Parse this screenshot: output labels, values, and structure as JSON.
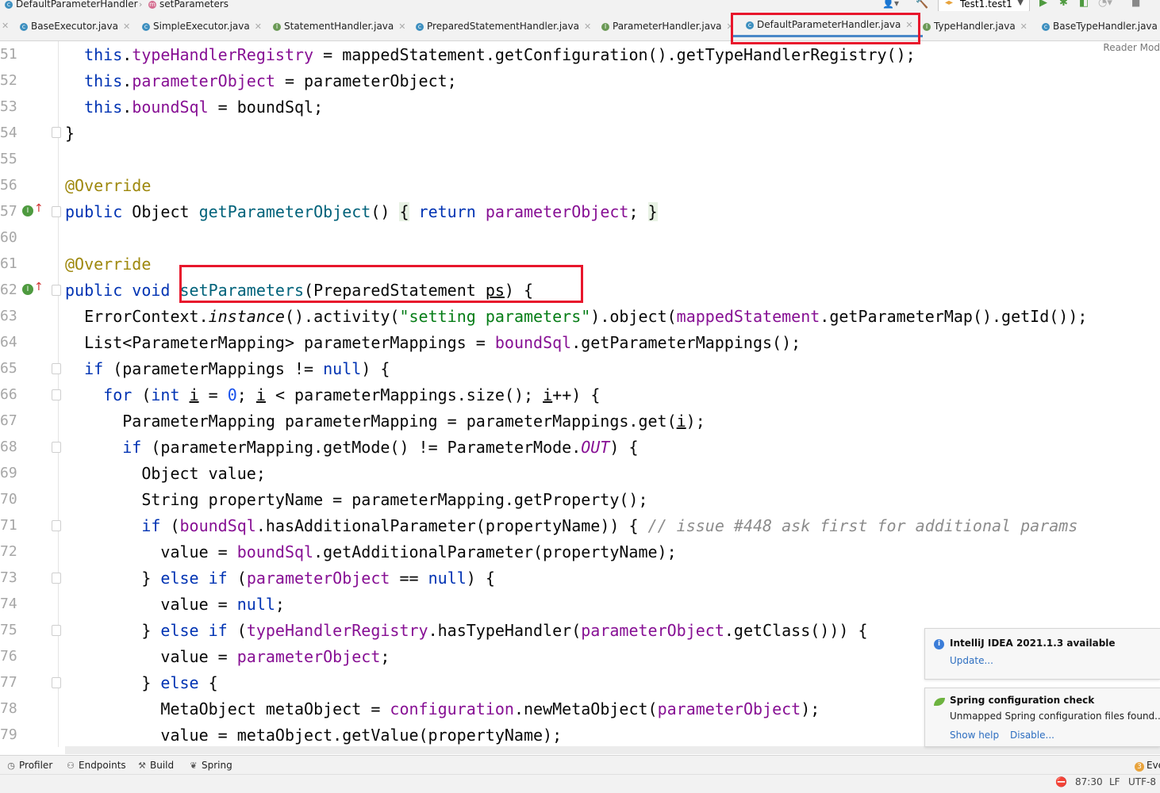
{
  "breadcrumb": {
    "items": [
      {
        "icon": "class-icon",
        "label": "DefaultParameterHandler"
      },
      {
        "icon": "method-icon",
        "label": "setParameters"
      }
    ]
  },
  "toolbar": {
    "run_config": "Test1.test1"
  },
  "tabs": [
    {
      "label": "BaseExecutor.java",
      "icon": "class-icon",
      "active": false
    },
    {
      "label": "SimpleExecutor.java",
      "icon": "class-icon",
      "active": false
    },
    {
      "label": "StatementHandler.java",
      "icon": "interface-icon",
      "active": false
    },
    {
      "label": "PreparedStatementHandler.java",
      "icon": "class-icon",
      "active": false
    },
    {
      "label": "ParameterHandler.java",
      "icon": "interface-icon",
      "active": false
    },
    {
      "label": "DefaultParameterHandler.java",
      "icon": "class-icon",
      "active": true
    },
    {
      "label": "TypeHandler.java",
      "icon": "interface-icon",
      "active": false
    },
    {
      "label": "BaseTypeHandler.java",
      "icon": "class-icon",
      "active": false
    }
  ],
  "editor": {
    "reader_mode": "Reader Mod",
    "line_numbers": [
      "51",
      "52",
      "53",
      "54",
      "55",
      "56",
      "57",
      "60",
      "61",
      "62",
      "63",
      "64",
      "65",
      "66",
      "67",
      "68",
      "69",
      "70",
      "71",
      "72",
      "73",
      "74",
      "75",
      "76",
      "77",
      "78",
      "79"
    ],
    "comment_issue": "// issue #448 ask first for additional params"
  },
  "tool_windows": [
    {
      "label": "Profiler",
      "icon": "profiler-icon"
    },
    {
      "label": "Endpoints",
      "icon": "endpoints-icon"
    },
    {
      "label": "Build",
      "icon": "hammer-icon"
    },
    {
      "label": "Spring",
      "icon": "spring-leaf-icon"
    }
  ],
  "event_log": {
    "count": "3",
    "label": "Eve"
  },
  "status": {
    "position": "87:30",
    "line_sep": "LF",
    "encoding": "UTF-8"
  },
  "notifications": [
    {
      "title": "IntelliJ IDEA 2021.1.3 available",
      "links": [
        "Update..."
      ]
    },
    {
      "title": "Spring configuration check",
      "body": "Unmapped Spring configuration files found...",
      "links": [
        "Show help",
        "Disable..."
      ]
    }
  ],
  "colors": {
    "highlight_box": "#e8162c",
    "active_tab_underline": "#4a88c7",
    "keyword": "#0033b3",
    "field": "#871094"
  }
}
